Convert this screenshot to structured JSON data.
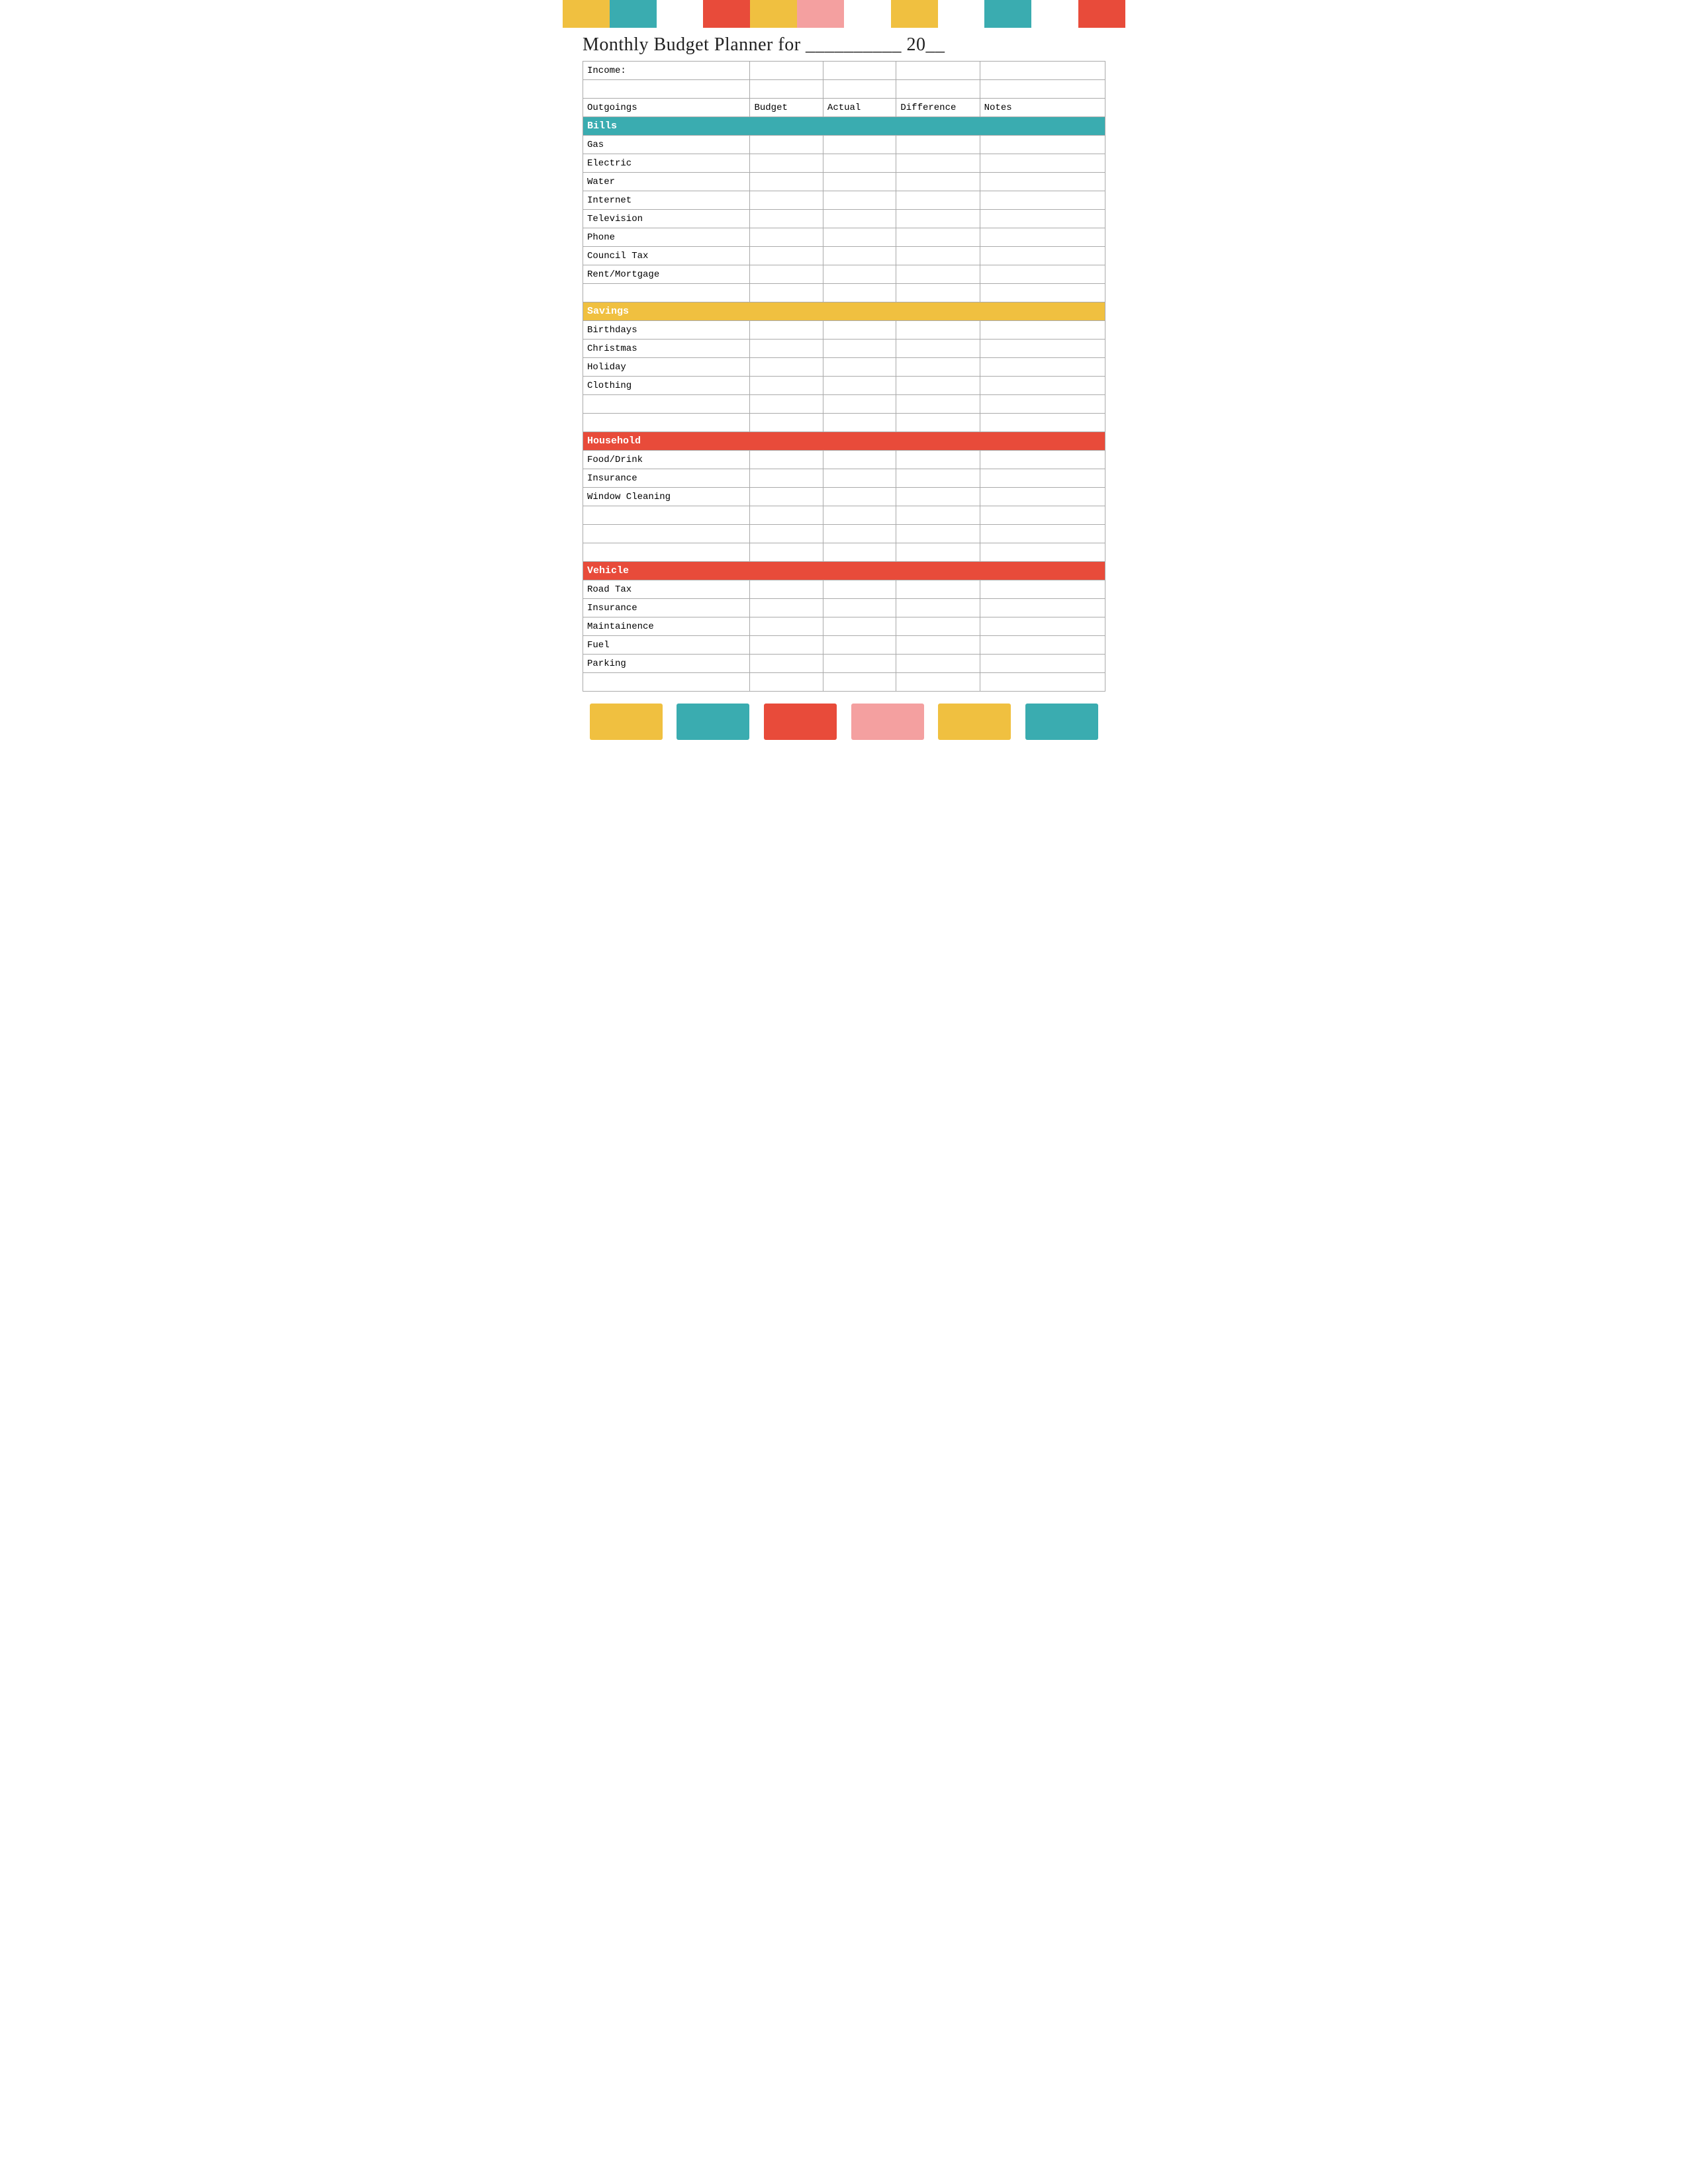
{
  "title": "Monthly Budget Planner for __________ 20__",
  "colorBarsTop": [
    {
      "color": "#f0c040",
      "name": "yellow"
    },
    {
      "color": "#3aacb0",
      "name": "teal"
    },
    {
      "color": "#ffffff",
      "name": "white-gap"
    },
    {
      "color": "#e84b3a",
      "name": "red"
    },
    {
      "color": "#f0c040",
      "name": "yellow2"
    },
    {
      "color": "#f4a0a0",
      "name": "pink"
    },
    {
      "color": "#ffffff",
      "name": "white-gap2"
    },
    {
      "color": "#f0c040",
      "name": "yellow3"
    },
    {
      "color": "#ffffff",
      "name": "white-gap3"
    },
    {
      "color": "#3aacb0",
      "name": "teal2"
    },
    {
      "color": "#ffffff",
      "name": "white-gap4"
    },
    {
      "color": "#e84b3a",
      "name": "red2"
    }
  ],
  "colorBarsBottom": [
    {
      "color": "#f0c040",
      "name": "yellow"
    },
    {
      "color": "#3aacb0",
      "name": "teal"
    },
    {
      "color": "#e84b3a",
      "name": "red"
    },
    {
      "color": "#f4a0a0",
      "name": "pink"
    },
    {
      "color": "#f0c040",
      "name": "yellow2"
    },
    {
      "color": "#3aacb0",
      "name": "teal2"
    }
  ],
  "table": {
    "incomeLabel": "Income:",
    "columns": [
      "Outgoings",
      "Budget",
      "Actual",
      "Difference",
      "Notes"
    ],
    "sections": [
      {
        "categoryLabel": "Bills",
        "categoryColor": "bills",
        "rows": [
          "Gas",
          "Electric",
          "Water",
          "Internet",
          "Television",
          "Phone",
          "Council Tax",
          "Rent/Mortgage",
          ""
        ]
      },
      {
        "categoryLabel": "Savings",
        "categoryColor": "savings",
        "rows": [
          "Birthdays",
          "Christmas",
          "Holiday",
          "Clothing",
          "",
          ""
        ]
      },
      {
        "categoryLabel": "Household",
        "categoryColor": "household",
        "rows": [
          "Food/Drink",
          "Insurance",
          "Window Cleaning",
          "",
          "",
          ""
        ]
      },
      {
        "categoryLabel": "Vehicle",
        "categoryColor": "vehicle",
        "rows": [
          "Road Tax",
          "Insurance",
          "Maintainence",
          "Fuel",
          "Parking",
          ""
        ]
      }
    ]
  }
}
